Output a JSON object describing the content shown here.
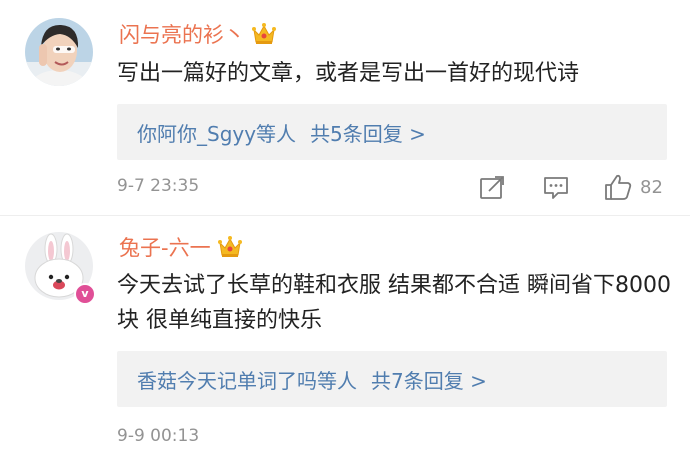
{
  "comments": [
    {
      "username": "闪与亮的衫丶",
      "badge_icon": "crown-icon",
      "text": "写出一篇好的文章，或者是写出一首好的现代诗",
      "reply_preview": {
        "users": "你阿你_Sgyy等人",
        "count_label": "共5条回复 >"
      },
      "timestamp": "9-7 23:35",
      "actions": {
        "share_icon": "share-icon",
        "comment_icon": "comment-icon",
        "like_icon": "like-icon",
        "like_count": "82"
      }
    },
    {
      "username": "兔子-六一",
      "badge_icon": "crown-icon",
      "verified_mark": "v",
      "text": "今天去试了长草的鞋和衣服 结果都不合适 瞬间省下8000块 很单纯直接的快乐",
      "reply_preview": {
        "users": "香菇今天记单词了吗等人",
        "count_label": "共7条回复 >"
      },
      "timestamp": "9-9 00:13"
    }
  ],
  "colors": {
    "username": "#eb7350",
    "link": "#507daf",
    "meta": "#939393",
    "text": "#222222",
    "reply_bg": "#f2f2f2",
    "crown": "#f5b921",
    "verified": "#e04f97"
  }
}
